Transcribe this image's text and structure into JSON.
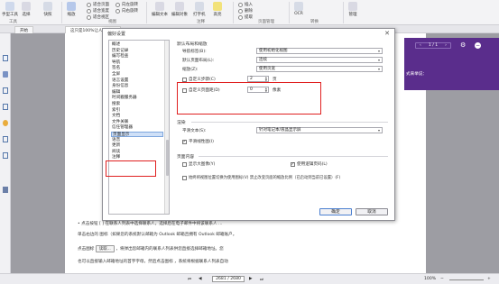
{
  "ribbon": {
    "buttons": [
      {
        "label": "手型工具"
      },
      {
        "label": "选择"
      },
      {
        "label": "快照"
      },
      {
        "label": "剪贴板"
      },
      {
        "label": "缩放"
      },
      {
        "label": "编辑文本"
      },
      {
        "label": "编辑对象"
      },
      {
        "label": "打字机"
      },
      {
        "label": "高亮"
      },
      {
        "label": "管理"
      }
    ],
    "radio_options": [
      "适合页面",
      "适合宽度",
      "适合视区"
    ],
    "view_options": [
      "向左旋转",
      "向右旋转"
    ],
    "page_options": [
      "插入",
      "删除",
      "提取"
    ],
    "ocr_label": "OCR",
    "groups": [
      "工具",
      "视图",
      "注释",
      "页面管理",
      "转换"
    ]
  },
  "tabs": [
    {
      "label": "开始"
    },
    {
      "label": "这只是100%让人up的..."
    }
  ],
  "purple_panel": {
    "nav_prev": "‹",
    "nav_text": "1 / 1",
    "nav_next": "›",
    "text": "式来举说："
  },
  "document": {
    "lines": [
      "• 点击按钮 [           ] 在联系人列表中选择联系人，选择后在电子邮件中将该联系人 ...",
      "单击右边的 图标（如果您的系统默认邮箱为 Outlook 邮箱且拥有 Outlook 邮箱账户。",
      "点击图标",
      "，将弹出您邮箱内的联系人列表供您直接选择邮箱地址。您",
      "也可以直接输入邮箱地址的首字字母，然后点击图标 ，系统将根据联系人列表自动"
    ],
    "inline_button": "读取..."
  },
  "statusbar": {
    "page_value": "2681 / 2680",
    "zoom": "100%"
  },
  "dialog": {
    "title": "偏好设置",
    "close": "✕",
    "categories": [
      "概述",
      "历史记录",
      "编写检查",
      "导航",
      "签名",
      "全屏",
      "语言设置",
      "身份信息",
      "编辑",
      "时间戳服务器",
      "搜索",
      "索引",
      "文档",
      "文件关联",
      "信任管理器",
      "页面显示",
      "语音",
      "更新",
      "阅读",
      "注释"
    ],
    "selected_category": "页面显示",
    "nav_section_title": "默认布局和缩放",
    "nav_tab_label": "导航标签(B):",
    "nav_tab_value": "使用初始化视图",
    "default_layout_label": "默认页面布局(L):",
    "default_layout_value": "连续",
    "zoom_label": "缩放(Z):",
    "zoom_value": "使用页宽",
    "custom_zoom_label": "自定义步骤(C)",
    "custom_zoom_value": "2",
    "custom_zoom_unit": "页",
    "custom_spacing_label": "自定义页面距(D)",
    "custom_spacing_value": "0",
    "custom_spacing_unit": "像素",
    "render_section_title": "渲染",
    "smooth_text_label": "平滑文本(S):",
    "smooth_text_value": "针对笔记本/液晶显示屏",
    "smooth_image_label": "平滑线性图(I)",
    "page_content_section_title": "页面内容",
    "show_large_images_label": "显示大图像(Y)",
    "use_logical_page_label": "使用逻辑页码(L)",
    "overprint_label": "始终将视图位置切换为使用图标(V)  禁止改变页面的缩放比例（已启动到当前已设置）(F)",
    "ok_label": "确定",
    "cancel_label": "取消"
  }
}
